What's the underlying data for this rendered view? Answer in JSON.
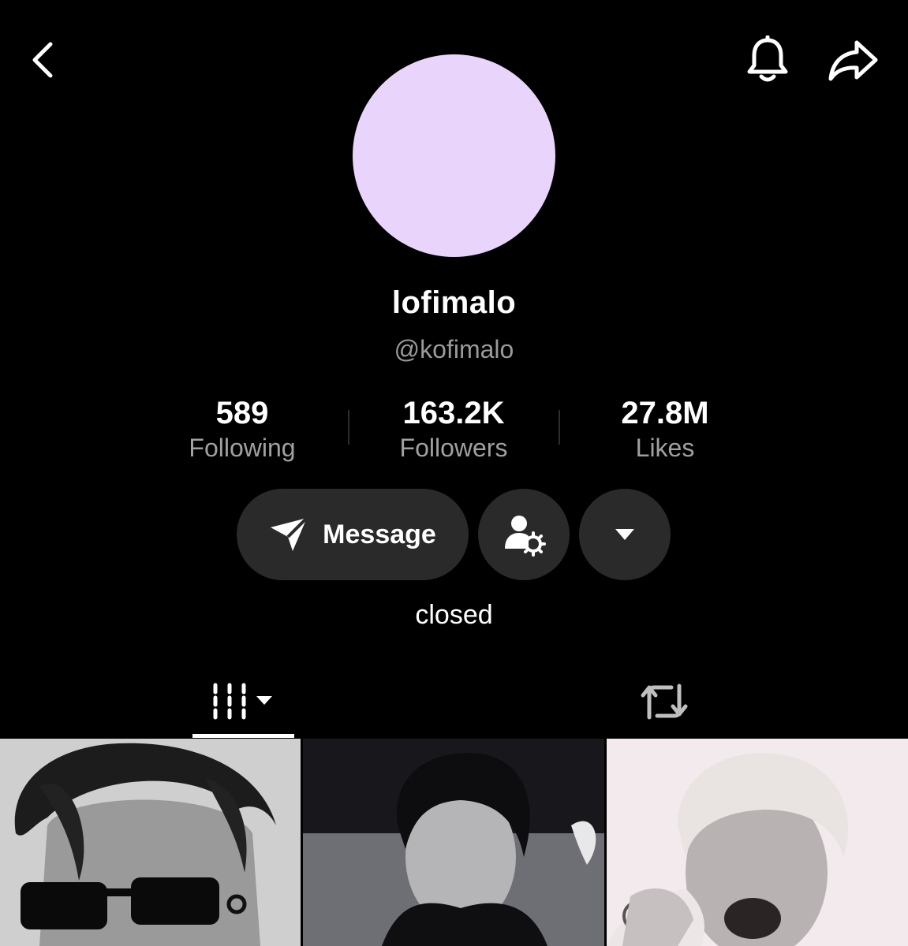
{
  "profile": {
    "display_name": "lofimalo",
    "handle": "@kofimalo",
    "bio": "closed",
    "avatar_color": "#E9D5FB"
  },
  "stats": [
    {
      "value": "589",
      "label": "Following"
    },
    {
      "value": "163.2K",
      "label": "Followers"
    },
    {
      "value": "27.8M",
      "label": "Likes"
    }
  ],
  "actions": {
    "message_label": "Message"
  },
  "icons": {
    "back": "back-chevron-icon",
    "notifications": "bell-icon",
    "share": "share-arrow-icon",
    "message": "paper-plane-icon",
    "friend_settings": "person-gear-icon",
    "more": "caret-down-icon",
    "videos_tab": "grid-lines-icon",
    "reposts_tab": "repost-icon"
  },
  "tabs": [
    {
      "name": "videos",
      "selected": true
    },
    {
      "name": "reposts",
      "selected": false
    }
  ],
  "videos": [
    {
      "thumb_tone": "light-gray"
    },
    {
      "thumb_tone": "dark"
    },
    {
      "thumb_tone": "pale-pink"
    }
  ]
}
